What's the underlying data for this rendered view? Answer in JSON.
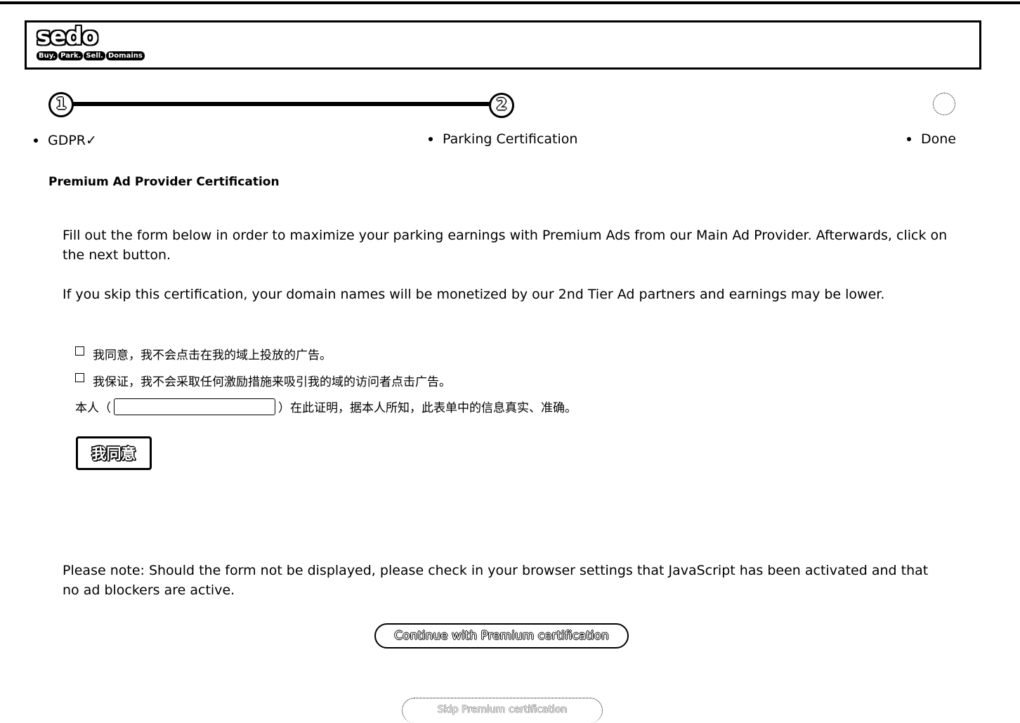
{
  "header": {
    "logo_word": "sedo",
    "logo_tags": [
      "Buy.",
      "Park.",
      "Sell.",
      "Domains"
    ]
  },
  "progress": {
    "steps": [
      {
        "number": "1",
        "label": "GDPR✓"
      },
      {
        "number": "2",
        "label": "Parking Certification"
      },
      {
        "number": "",
        "label": "Done"
      }
    ]
  },
  "main": {
    "section_title": "Premium Ad Provider Certification",
    "intro_1": "Fill out the form below in order to maximize your parking earnings with Premium Ads from our Main Ad Provider. Afterwards, click on the next button.",
    "intro_2": "If you skip this certification, your domain names will be monetized by our 2nd Tier Ad partners and earnings may be lower.",
    "check_1": "我同意，我不会点击在我的域上投放的广告。",
    "check_2": "我保证，我不会采取任何激励措施来吸引我的域的访问者点击广告。",
    "cert_prefix": "本人（",
    "cert_input_value": "",
    "cert_suffix": "）在此证明，据本人所知，此表单中的信息真实、准确。",
    "agree_button": "我同意",
    "note": "Please note: Should the form not be displayed, please check in your browser settings that JavaScript has been activated and that no ad blockers are active.",
    "continue_button": "Continue with Premium certification",
    "skip_button": "Skip Premium certification"
  }
}
